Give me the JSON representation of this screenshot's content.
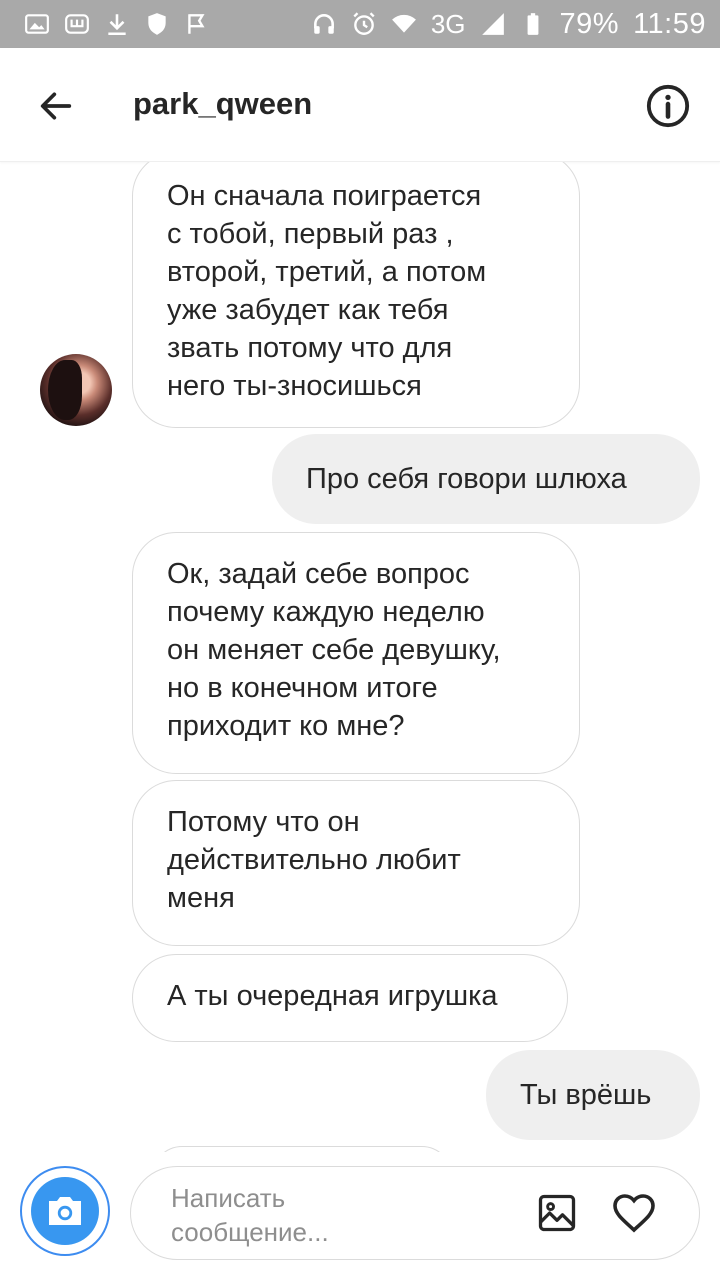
{
  "status_bar": {
    "battery_percent": "79%",
    "network": "3G",
    "time": "11:59"
  },
  "header": {
    "username": "park_qween"
  },
  "messages": [
    {
      "direction": "incoming",
      "lines": [
        "Он сначала поиграется",
        "с тобой, первый раз ,",
        "второй, третий, а потом",
        "уже забудет как тебя",
        "звать потому что для",
        "него ты-зносишься"
      ]
    },
    {
      "direction": "outgoing",
      "lines": [
        "Про себя говори шлюха"
      ]
    },
    {
      "direction": "incoming",
      "lines": [
        "Ок, задай себе вопрос",
        "почему каждую неделю",
        "он меняет себе девушку,",
        "но в конечном итоге",
        "приходит ко мне?"
      ]
    },
    {
      "direction": "incoming",
      "lines": [
        "Потому что он",
        "действительно любит",
        "меня"
      ]
    },
    {
      "direction": "incoming",
      "lines": [
        "А ты очередная игрушка"
      ]
    },
    {
      "direction": "outgoing",
      "lines": [
        "Ты врёшь"
      ]
    }
  ],
  "composer": {
    "placeholder_line1": "Написать",
    "placeholder_line2": "сообщение..."
  },
  "icons": {
    "back": "arrow-left-icon",
    "info": "info-icon",
    "camera": "camera-icon",
    "gallery": "image-icon",
    "like": "heart-icon"
  },
  "colors": {
    "status_bar_bg": "#a9a9a9",
    "camera_blue": "#3897f0",
    "outgoing_bubble": "#efefef",
    "incoming_border": "#dbdbdb"
  }
}
